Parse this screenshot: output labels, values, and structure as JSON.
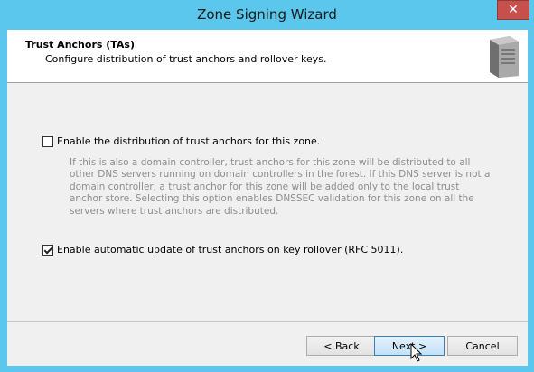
{
  "window": {
    "title": "Zone Signing Wizard",
    "close_glyph": "✕"
  },
  "header": {
    "title": "Trust Anchors (TAs)",
    "subtitle": "Configure distribution of trust anchors and rollover keys.",
    "icon": "server-icon"
  },
  "options": {
    "distribute": {
      "label": "Enable the distribution of trust anchors for this zone.",
      "checked": false
    },
    "description": "If this is also a domain controller, trust anchors for this zone will be distributed to all other DNS servers running on domain controllers in the forest. If this DNS server is not a domain controller, a trust anchor for this zone will be added only to the local trust anchor store. Selecting this option enables DNSSEC validation for this zone on all the servers where trust anchors are distributed.",
    "auto_update": {
      "label": "Enable automatic update of trust anchors on key rollover (RFC 5011).",
      "checked": true
    }
  },
  "buttons": {
    "back": "< Back",
    "next": "Next >",
    "cancel": "Cancel"
  },
  "colors": {
    "title_bar": "#5bc7ec",
    "close_button": "#c7504d",
    "description_text": "#8d8d8d"
  }
}
